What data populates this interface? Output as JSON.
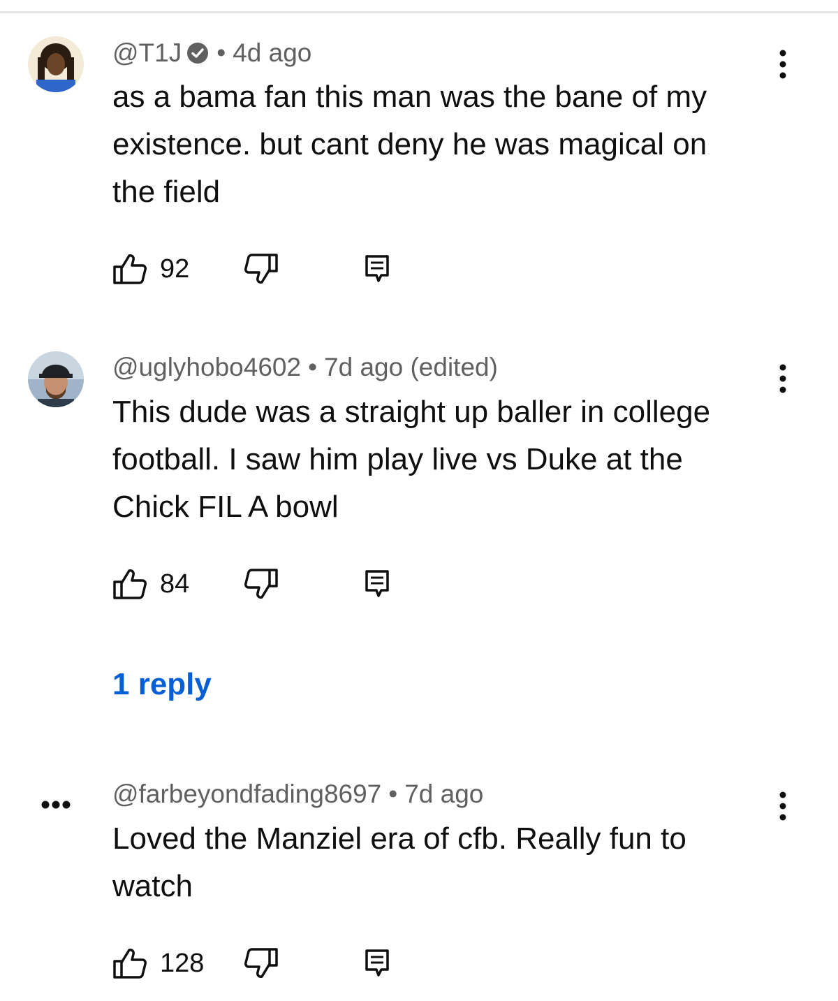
{
  "comments": [
    {
      "author": "@T1J",
      "verified": true,
      "time": "4d ago",
      "edited": "",
      "text": "as a bama fan this man was the bane of my existence. but cant deny he was magical on the field",
      "likes": "92",
      "avatar_icon": "user-avatar-photo",
      "more_icon": "more-vert-icon"
    },
    {
      "author": "@uglyhobo4602",
      "verified": false,
      "time": "7d ago (edited)",
      "text": "This dude was a straight up baller in college football. I saw him play live vs Duke at the Chick FIL A bowl",
      "likes": "84",
      "replies_label": "1 reply",
      "avatar_icon": "user-avatar-photo",
      "more_icon": "more-vert-icon"
    },
    {
      "author": "@farbeyondfading8697",
      "verified": false,
      "time": "7d ago",
      "text": "Loved the Manziel era of cfb. Really fun to watch",
      "likes": "128",
      "avatar_icon": "ellipsis-avatar",
      "more_icon": "more-vert-icon"
    }
  ],
  "separator": "•",
  "colors": {
    "text": "#0f0f0f",
    "meta": "#606060",
    "link": "#065fd4",
    "divider": "#e5e5e5"
  }
}
